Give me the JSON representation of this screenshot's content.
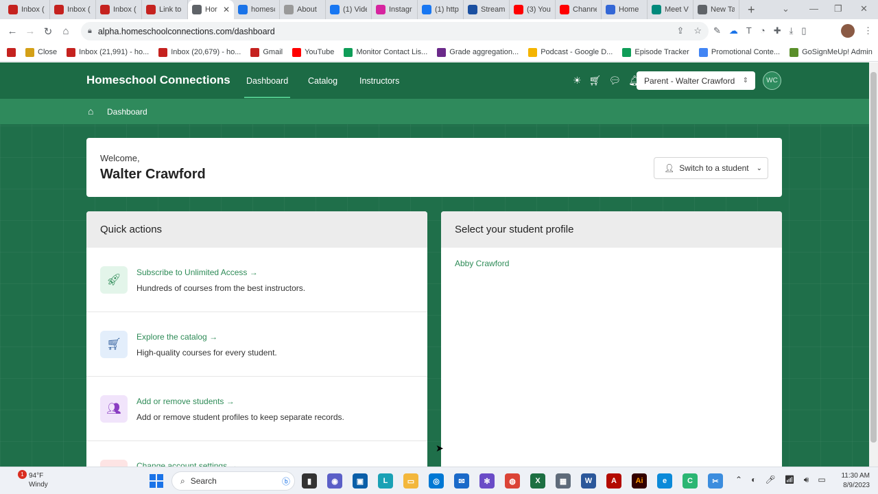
{
  "browser": {
    "tabs": [
      {
        "label": "Inbox (",
        "favicon": "gmail-icon",
        "color": "#c5221f"
      },
      {
        "label": "Inbox (",
        "favicon": "gmail-icon",
        "color": "#c5221f"
      },
      {
        "label": "Inbox (",
        "favicon": "gmail-icon",
        "color": "#c5221f"
      },
      {
        "label": "Link to",
        "favicon": "gmail-icon",
        "color": "#c5221f"
      },
      {
        "label": "Hor",
        "favicon": "globe-icon",
        "color": "#5f6368",
        "active": true
      },
      {
        "label": "homesc",
        "favicon": "docs-icon",
        "color": "#1a73e8"
      },
      {
        "label": "About",
        "favicon": "tab-icon",
        "color": "#999999"
      },
      {
        "label": "(1) Vide",
        "favicon": "facebook-icon",
        "color": "#1877f2"
      },
      {
        "label": "Instagr",
        "favicon": "instagram-icon",
        "color": "#d6249f"
      },
      {
        "label": "(1) http",
        "favicon": "facebook-icon",
        "color": "#1877f2"
      },
      {
        "label": "Stream",
        "favicon": "stream-icon",
        "color": "#1a4fa0"
      },
      {
        "label": "(3) You",
        "favicon": "youtube-icon",
        "color": "#ff0000"
      },
      {
        "label": "Channe",
        "favicon": "youtube-icon",
        "color": "#ff0000"
      },
      {
        "label": "Home",
        "favicon": "home-app-icon",
        "color": "#3367d6"
      },
      {
        "label": "Meet V",
        "favicon": "meet-icon",
        "color": "#00897b"
      },
      {
        "label": "New Ta",
        "favicon": "globe-icon",
        "color": "#5f6368"
      }
    ],
    "url": "alpha.homeschoolconnections.com/dashboard",
    "bookmarks": [
      {
        "label": "",
        "icon": "gmail-icon",
        "color": "#c5221f"
      },
      {
        "label": "Close",
        "icon": "close-app-icon",
        "color": "#d4a017"
      },
      {
        "label": "Inbox (21,991) - ho...",
        "icon": "gmail-icon",
        "color": "#c5221f"
      },
      {
        "label": "Inbox (20,679) - ho...",
        "icon": "gmail-icon",
        "color": "#c5221f"
      },
      {
        "label": "Gmail",
        "icon": "gmail-icon",
        "color": "#c5221f"
      },
      {
        "label": "YouTube",
        "icon": "youtube-icon",
        "color": "#ff0000"
      },
      {
        "label": "Monitor Contact Lis...",
        "icon": "sheets-icon",
        "color": "#0f9d58"
      },
      {
        "label": "Grade aggregation...",
        "icon": "monitor-icon",
        "color": "#6b2a8a"
      },
      {
        "label": "Podcast - Google D...",
        "icon": "drive-icon",
        "color": "#f4b400"
      },
      {
        "label": "Episode Tracker",
        "icon": "sheets-icon",
        "color": "#0f9d58"
      },
      {
        "label": "Promotional Conte...",
        "icon": "docs-icon",
        "color": "#4285f4"
      },
      {
        "label": "GoSignMeUp! Admin",
        "icon": "gosignmeup-icon",
        "color": "#5a8f2a"
      }
    ]
  },
  "app": {
    "brand": "Homeschool Connections",
    "nav": {
      "dashboard": "Dashboard",
      "catalog": "Catalog",
      "instructors": "Instructors"
    },
    "account_select": "Parent - Walter Crawford",
    "avatar_initials": "WC",
    "breadcrumb": "Dashboard",
    "welcome": {
      "label": "Welcome,",
      "name": "Walter Crawford",
      "switch_button": "Switch to a student"
    },
    "quick_actions": {
      "title": "Quick actions",
      "items": [
        {
          "title": "Subscribe to Unlimited Access →",
          "desc": "Hundreds of courses from the best instructors.",
          "icon": "rocket-icon",
          "bg": "#e3f5ea",
          "fg": "#2e8b57"
        },
        {
          "title": "Explore the catalog →",
          "desc": "High-quality courses for every student.",
          "icon": "cart-icon",
          "bg": "#e3eefb",
          "fg": "#2e5c9b"
        },
        {
          "title": "Add or remove students →",
          "desc": "Add or remove student profiles to keep separate records.",
          "icon": "users-icon",
          "bg": "#f1e4fb",
          "fg": "#8a3dc2"
        },
        {
          "title": "Change account settings →",
          "desc": "",
          "icon": "settings-icon",
          "bg": "#fde4e4",
          "fg": "#c53030"
        }
      ]
    },
    "student_profiles": {
      "title": "Select your student profile",
      "students": [
        "Abby Crawford"
      ]
    }
  },
  "taskbar": {
    "weather_temp": "94°F",
    "weather_desc": "Windy",
    "weather_badge": "1",
    "search": "Search",
    "time": "11:30 AM",
    "date": "8/9/2023"
  }
}
